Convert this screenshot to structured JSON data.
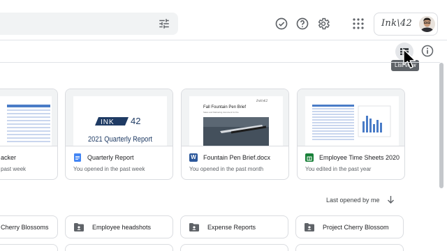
{
  "header": {
    "brand_text": "Ink\\42",
    "icons": [
      "tune-icon",
      "done-icon",
      "help-icon",
      "settings-icon",
      "apps-grid-icon"
    ]
  },
  "toolbar": {
    "tooltip": "List view"
  },
  "files": [
    {
      "title": "acker",
      "subtitle": "past week",
      "type": "sheet"
    },
    {
      "title": "Quarterly Report",
      "subtitle": "You opened in the past week",
      "type": "doc",
      "thumb_logo": "INK",
      "thumb_num": "42",
      "thumb_heading": "2021 Quarterly Report"
    },
    {
      "title": "Fountain Pen Brief.docx",
      "subtitle": "You opened in the past month",
      "type": "word",
      "thumb_heading": "Fall Fountain Pen Brief",
      "thumb_sub": "Sales and Marketing document for the",
      "thumb_brand": "Ink\\42"
    },
    {
      "title": "Employee Time Sheets 2020",
      "subtitle": "You edited in the past year",
      "type": "sheet"
    }
  ],
  "sort": {
    "label": "Last opened by me"
  },
  "folders": [
    {
      "name": "Cherry Blossoms"
    },
    {
      "name": "Employee headshots"
    },
    {
      "name": "Expense Reports"
    },
    {
      "name": "Project Cherry Blossom"
    }
  ],
  "colors": {
    "doc": "#4285f4",
    "word": "#2b579a",
    "sheet": "#188038",
    "ink_blue": "#1f3b64"
  }
}
